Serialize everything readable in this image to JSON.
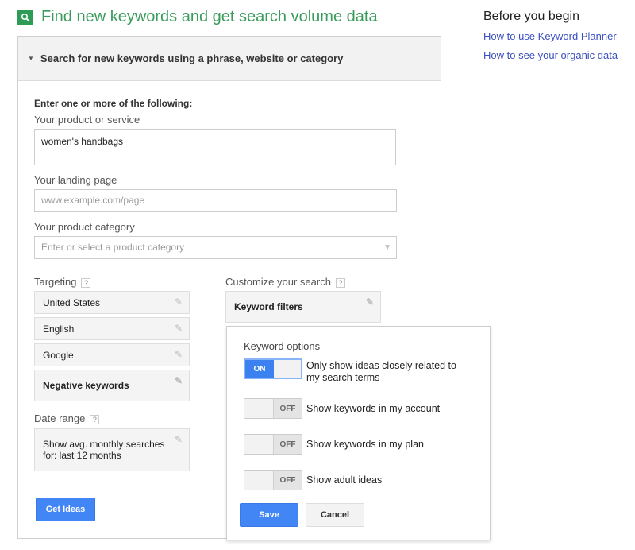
{
  "header": {
    "title": "Find new keywords and get search volume data",
    "icon": "search-icon"
  },
  "sidebar": {
    "heading": "Before you begin",
    "links": [
      "How to use Keyword Planner",
      "How to see your organic data"
    ]
  },
  "panel": {
    "section_title": "Search for new keywords using a phrase, website or category",
    "intro": "Enter one or more of the following:",
    "product_label": "Your product or service",
    "product_value": "women's handbags",
    "landing_label": "Your landing page",
    "landing_placeholder": "www.example.com/page",
    "category_label": "Your product category",
    "category_placeholder": "Enter or select a product category",
    "targeting_label": "Targeting",
    "targeting": [
      "United States",
      "English",
      "Google"
    ],
    "negative_keywords": "Negative keywords",
    "date_label": "Date range",
    "date_value_line1": "Show avg. monthly searches",
    "date_value_line2": "for: last 12 months",
    "customize_label": "Customize your search",
    "keyword_filters": "Keyword filters",
    "get_ideas": "Get Ideas",
    "help_glyph": "?"
  },
  "popup": {
    "heading": "Keyword options",
    "on_label": "ON",
    "off_label": "OFF",
    "options": [
      {
        "line1": "Only show ideas closely related to",
        "line2": "my search terms",
        "state": "on"
      },
      {
        "line1": "Show keywords in my account",
        "state": "off"
      },
      {
        "line1": "Show keywords in my plan",
        "state": "off"
      },
      {
        "line1": "Show adult ideas",
        "state": "off"
      }
    ],
    "save": "Save",
    "cancel": "Cancel"
  }
}
